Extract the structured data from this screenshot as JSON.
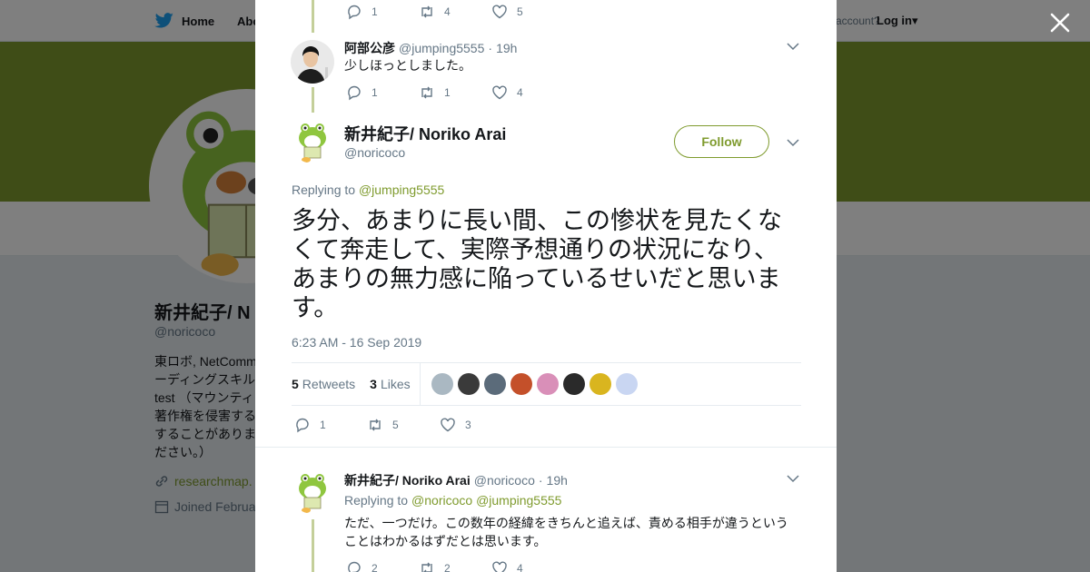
{
  "nav": {
    "home_label": "Home",
    "about_label": "Abo",
    "account_text": "account?",
    "login_label": "Log in"
  },
  "profile": {
    "name": "新井紀子/ N",
    "handle": "@noricoco",
    "bio": "東ロボ, NetComm\nーディングスキル\ntest （マウンティ\n著作権を侵害する\nすることがありま\nださい。）",
    "link": "researchmap.",
    "joined": "Joined Februa"
  },
  "thread": {
    "prev_actions": {
      "replies": "1",
      "retweets": "4",
      "likes": "5"
    },
    "reply1": {
      "name": "阿部公彦",
      "handle": "@jumping5555",
      "time": "19h",
      "text": "少しほっとしました。",
      "actions": {
        "replies": "1",
        "retweets": "1",
        "likes": "4"
      }
    },
    "main": {
      "name": "新井紀子/ Noriko Arai",
      "handle": "@noricoco",
      "follow_label": "Follow",
      "replying_prefix": "Replying to",
      "replying_handle": "@jumping5555",
      "text": "多分、あまりに長い間、この惨状を見たくなくて奔走して、実際予想通りの状況になり、あまりの無力感に陥っているせいだと思います。",
      "timestamp": "6:23 AM - 16 Sep 2019",
      "retweets_count": "5",
      "retweets_label": "Retweets",
      "likes_count": "3",
      "likes_label": "Likes",
      "actions": {
        "replies": "1",
        "retweets": "5",
        "likes": "3"
      }
    },
    "reply2": {
      "name": "新井紀子/ Noriko Arai",
      "handle": "@noricoco",
      "time": "19h",
      "replying_prefix": "Replying to",
      "replying_handles": "@noricoco @jumping5555",
      "text": "ただ、一つだけ。この数年の経緯をきちんと追えば、責める相手が違うということはわかるはずだとは思います。",
      "actions": {
        "replies": "2",
        "retweets": "2",
        "likes": "4"
      }
    }
  },
  "colors": {
    "accent": "#7f9b2e",
    "thread_line": "#c4cf9a",
    "text": "#14171a",
    "muted": "#657786"
  }
}
